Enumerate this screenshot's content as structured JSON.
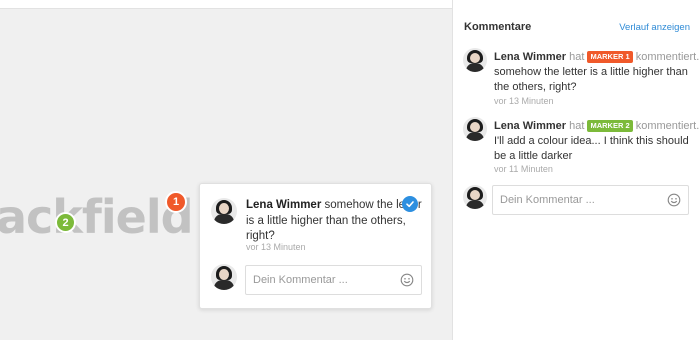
{
  "canvas": {
    "design_text": "ackfield",
    "markers": [
      {
        "number": "1",
        "color": "#f0592a"
      },
      {
        "number": "2",
        "color": "#7cba3a"
      }
    ]
  },
  "popup": {
    "author": "Lena Wimmer",
    "text": "somehow the letter is a little higher than the others, right?",
    "time": "vor 13 Minuten",
    "input_placeholder": "Dein Kommentar ..."
  },
  "panel": {
    "title": "Kommentare",
    "history_link": "Verlauf anzeigen",
    "comments": [
      {
        "author": "Lena Wimmer",
        "hat": "hat",
        "marker_label": "MARKER 1",
        "marker_color": "#f0592a",
        "verb": "kommentiert.",
        "text": "somehow the letter is a little higher than the others, right?",
        "time": "vor 13 Minuten"
      },
      {
        "author": "Lena Wimmer",
        "hat": "hat",
        "marker_label": "MARKER 2",
        "marker_color": "#7cba3a",
        "verb": "kommentiert.",
        "text": "I'll add a colour idea... I think this should be a little darker",
        "time": "vor 11 Minuten"
      }
    ],
    "input_placeholder": "Dein Kommentar ..."
  },
  "colors": {
    "accent": "#2f8bd6",
    "check": "#2d8fe0"
  }
}
